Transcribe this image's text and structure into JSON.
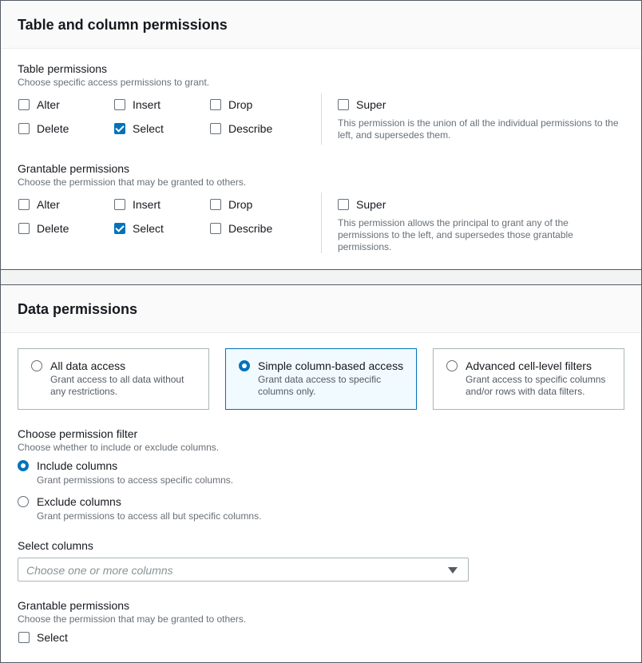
{
  "table_section": {
    "title": "Table and column permissions",
    "table_permissions": {
      "label": "Table permissions",
      "description": "Choose specific access permissions to grant.",
      "options": [
        {
          "label": "Alter",
          "checked": false
        },
        {
          "label": "Insert",
          "checked": false
        },
        {
          "label": "Drop",
          "checked": false
        },
        {
          "label": "Delete",
          "checked": false
        },
        {
          "label": "Select",
          "checked": true
        },
        {
          "label": "Describe",
          "checked": false
        }
      ],
      "super": {
        "label": "Super",
        "checked": false,
        "description": "This permission is the union of all the individual permissions to the left, and supersedes them."
      }
    },
    "grantable_permissions": {
      "label": "Grantable permissions",
      "description": "Choose the permission that may be granted to others.",
      "options": [
        {
          "label": "Alter",
          "checked": false
        },
        {
          "label": "Insert",
          "checked": false
        },
        {
          "label": "Drop",
          "checked": false
        },
        {
          "label": "Delete",
          "checked": false
        },
        {
          "label": "Select",
          "checked": true
        },
        {
          "label": "Describe",
          "checked": false
        }
      ],
      "super": {
        "label": "Super",
        "checked": false,
        "description": "This permission allows the principal to grant any of the permissions to the left, and supersedes those grantable permissions."
      }
    }
  },
  "data_section": {
    "title": "Data permissions",
    "access_tiles": [
      {
        "title": "All data access",
        "description": "Grant access to all data without any restrictions.",
        "selected": false
      },
      {
        "title": "Simple column-based access",
        "description": "Grant data access to specific columns only.",
        "selected": true
      },
      {
        "title": "Advanced cell-level filters",
        "description": "Grant access to specific columns and/or rows with data filters.",
        "selected": false
      }
    ],
    "permission_filter": {
      "label": "Choose permission filter",
      "description": "Choose whether to include or exclude columns.",
      "options": [
        {
          "label": "Include columns",
          "description": "Grant permissions to access specific columns.",
          "selected": true
        },
        {
          "label": "Exclude columns",
          "description": "Grant permissions to access all but specific columns.",
          "selected": false
        }
      ]
    },
    "select_columns": {
      "label": "Select columns",
      "placeholder": "Choose one or more columns"
    },
    "grantable_permissions": {
      "label": "Grantable permissions",
      "description": "Choose the permission that may be granted to others.",
      "options": [
        {
          "label": "Select",
          "checked": false
        }
      ]
    }
  }
}
